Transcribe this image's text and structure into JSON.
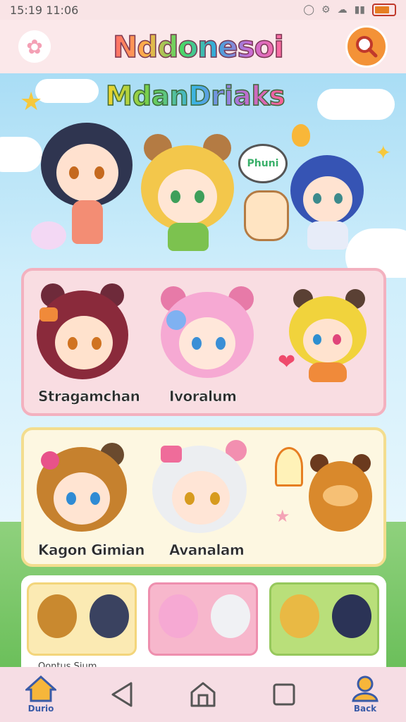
{
  "status_bar": {
    "time": "15:19 11:06",
    "icons": [
      "notification-icon",
      "settings-icon",
      "wifi-icon",
      "signal-icon",
      "battery-icon"
    ]
  },
  "header": {
    "title": "Nddonesoi",
    "flower_icon": "flower-icon",
    "search_icon": "search-icon",
    "accent": "#f39237"
  },
  "hero": {
    "subtitle": "MdanDriaks",
    "speech_text": "Phuni"
  },
  "featured_cards": [
    {
      "characters": [
        "red-haired-girl",
        "pink-haired-girl",
        "yellow-haired-bear"
      ],
      "labels": [
        "Stragamchan",
        "Ivoralum"
      ]
    },
    {
      "characters": [
        "brown-haired-boy",
        "white-haired-girl",
        "orange-bear"
      ],
      "labels": [
        "Kagon Gimian",
        "Avanalam"
      ]
    }
  ],
  "mini_cards": [
    {
      "color": "#fbeab3",
      "characters": [
        "bear-boy",
        "gray-boy"
      ]
    },
    {
      "color": "#f7b7cc",
      "characters": [
        "pink-girl",
        "white-girl"
      ]
    },
    {
      "color": "#b9df7a",
      "characters": [
        "blonde-girl",
        "navy-girl"
      ]
    }
  ],
  "mini_caption": "Oontus Sium",
  "bottom_nav": {
    "home_label": "Durio",
    "back_label": "Back",
    "items": [
      "home-icon",
      "back-triangle-icon",
      "home-outline-icon",
      "square-icon",
      "profile-icon"
    ]
  }
}
